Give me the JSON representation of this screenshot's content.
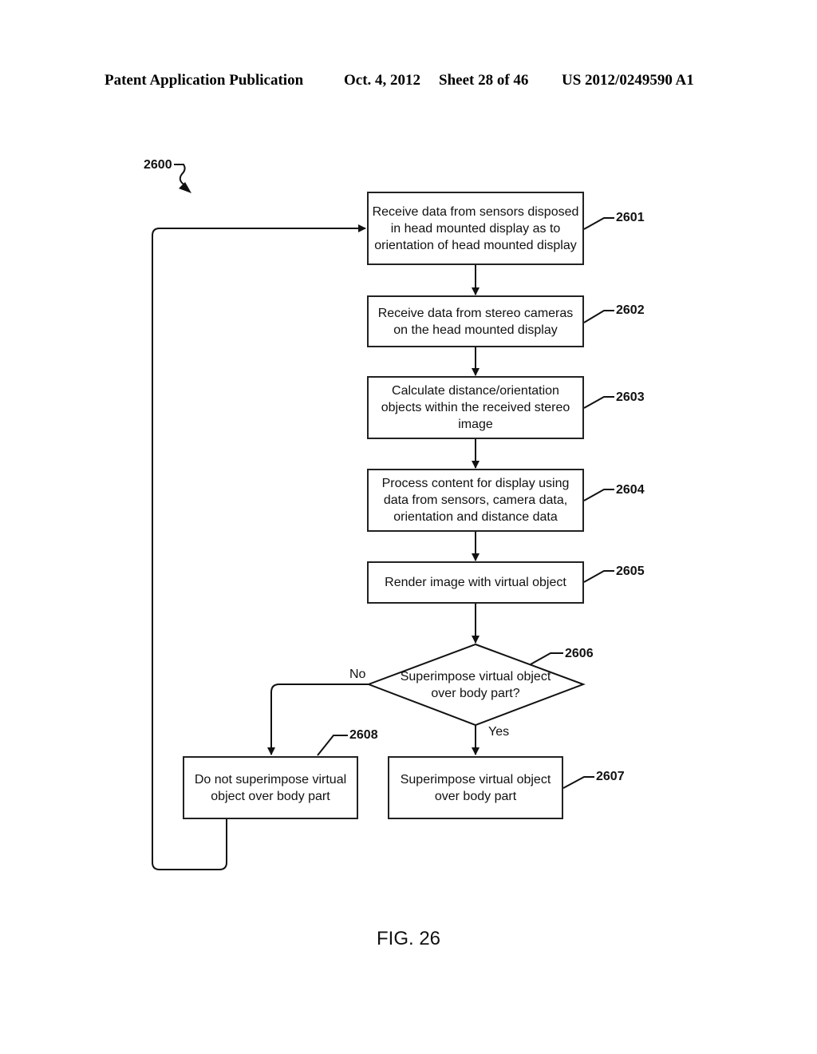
{
  "header": {
    "publication": "Patent Application Publication",
    "date": "Oct. 4, 2012",
    "sheet": "Sheet 28 of 46",
    "number": "US 2012/0249590 A1"
  },
  "figure_ref": "2600",
  "steps": [
    {
      "id": "2601",
      "text": "Receive data from sensors disposed in head mounted display as to orientation of head mounted display"
    },
    {
      "id": "2602",
      "text": "Receive data from stereo cameras on the head mounted display"
    },
    {
      "id": "2603",
      "text": "Calculate distance/orientation objects within the received stereo image"
    },
    {
      "id": "2604",
      "text": "Process content for display using data from sensors, camera data, orientation and distance data"
    },
    {
      "id": "2605",
      "text": "Render image with virtual object"
    }
  ],
  "decision": {
    "id": "2606",
    "text": "Superimpose virtual object over body part?",
    "no_label": "No",
    "yes_label": "Yes"
  },
  "outcomes": [
    {
      "id": "2607",
      "text": "Superimpose virtual object over body part"
    },
    {
      "id": "2608",
      "text": "Do not superimpose virtual object over body part"
    }
  ],
  "caption": "FIG. 26"
}
